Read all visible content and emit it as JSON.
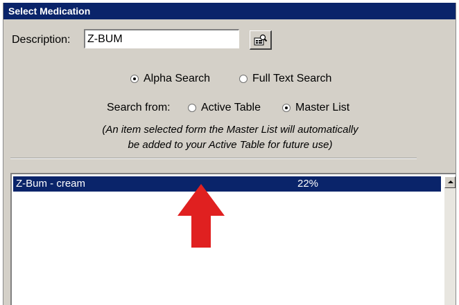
{
  "window": {
    "title": "Select Medication"
  },
  "description": {
    "label": "Description:",
    "value": "Z-BUM"
  },
  "lookup_button": {
    "icon": "lookup-icon"
  },
  "search_type": {
    "options": [
      {
        "label": "Alpha Search",
        "checked": true
      },
      {
        "label": "Full Text Search",
        "checked": false
      }
    ]
  },
  "search_from": {
    "label": "Search from:",
    "options": [
      {
        "label": "Active Table",
        "checked": false
      },
      {
        "label": "Master List",
        "checked": true
      }
    ]
  },
  "note": {
    "line1": "(An item selected form the Master List will automatically",
    "line2": "be added to your Active Table for future use)"
  },
  "results": {
    "rows": [
      {
        "name": "Z-Bum - cream",
        "percent": "22%",
        "selected": true
      }
    ]
  },
  "colors": {
    "title_bar": "#0a246a",
    "selection": "#0a246a",
    "dialog_face": "#d4d0c8",
    "annotation_arrow": "#e02020"
  }
}
